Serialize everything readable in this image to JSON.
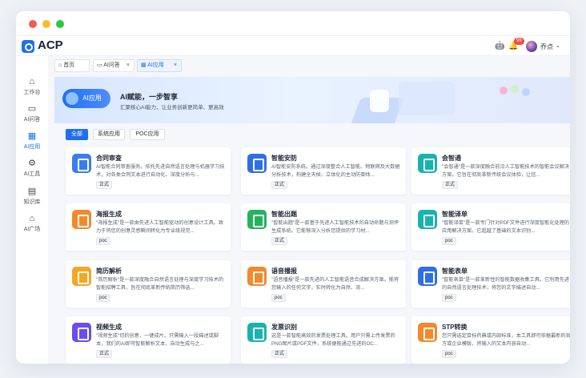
{
  "app": {
    "title": "ACP"
  },
  "header": {
    "notif_count": "99",
    "user_name": "乔点"
  },
  "sidebar": {
    "items": [
      {
        "label": "工作台",
        "icon": "home-icon"
      },
      {
        "label": "AI问答",
        "icon": "chat-icon"
      },
      {
        "label": "AI应用",
        "icon": "apps-icon",
        "active": true
      },
      {
        "label": "AI工具",
        "icon": "tools-icon"
      },
      {
        "label": "知识库",
        "icon": "book-icon"
      },
      {
        "label": "AI广场",
        "icon": "plaza-icon"
      }
    ]
  },
  "tabs": [
    {
      "label": "首页",
      "icon": "home-icon"
    },
    {
      "label": "AI问答",
      "icon": "chat-icon",
      "closable": true
    },
    {
      "label": "AI应用",
      "icon": "apps-icon",
      "closable": true,
      "active": true
    }
  ],
  "hero": {
    "pill": "AI应用",
    "title": "AI赋能，一步智享",
    "subtitle": "汇聚核心AI能力，让业务创新更简单、更高效"
  },
  "filters": [
    "全部",
    "系统应用",
    "POC应用"
  ],
  "cards": [
    {
      "title": "合同审查",
      "desc": "AI智能合同审查服务。依托先进自然语言处理与机器学习技术，对各类合同文本进行自动化、深度分析与...",
      "tag": "正式",
      "color": "#3b7cf0"
    },
    {
      "title": "智能安防",
      "desc": "AI智能安防系统。通过深度整合人工智能、物联网及大数据分析技术，构建全天候、立体化的主动防御体...",
      "tag": "正式",
      "color": "#2f6fe4"
    },
    {
      "title": "会智通",
      "desc": "\"会智通\"是一款深度融合前沿人工智能技术的智能会议解决方案。它旨在彻底革新传统会议体验，让信...",
      "tag": "正式",
      "color": "#17b3b0"
    },
    {
      "title": "海报生成",
      "desc": "\"海报生成\"是一款由先进人工智能驱动的创意设计工具。致力于将您的创意灵感瞬间转化为专业级视觉...",
      "tag": "poc",
      "color": "#f28a2c"
    },
    {
      "title": "智能出题",
      "desc": "\"智能出题\"是一款基于先进人工智能技术的自动命题与测评生成系统。它能够深入分析您提供的学习材...",
      "tag": "正式",
      "color": "#22b35e"
    },
    {
      "title": "智能译单",
      "desc": "\"智能译单\"是一款专门针对PDF文件进行深度智能化处理的应用解决方案。它超越了基础的文本识别...",
      "tag": "poc",
      "color": "#17b3b0"
    },
    {
      "title": "简历解析",
      "desc": "\"简历解析\"是一款深度融合自然语言处理与深度学习技术的智能招聘工具，旨在彻底革新传统简历筛选...",
      "tag": "poc",
      "color": "#f5a623"
    },
    {
      "title": "语音播报",
      "desc": "\"语音播报\"是一款先进的人工智能语音合成解决方案。能将您输入的任何文字，实时转化为自然、流...",
      "tag": "poc",
      "color": "#f28a2c"
    },
    {
      "title": "智能表单",
      "desc": "\"智能表单\"是一款革新性的智能数据收集工具。它利用先进的自然语言处理技术，将您的文字描述自动...",
      "tag": "poc",
      "color": "#2f6fe4"
    },
    {
      "title": "视频生成",
      "desc": "\"视频生成\"切的创意，一键成片。只需输入一段描述或脚本，我们的AI即可智能解析文本，自动生成与之...",
      "tag": "正式",
      "color": "#6a4cf0"
    },
    {
      "title": "发票识别",
      "desc": "这是一款智能高效的发票处理工具。用户只需上传发票的PNG图片或PDF文件，系统便能通过先进的OC...",
      "tag": "正式",
      "color": "#17b3b0"
    },
    {
      "title": "STP转换",
      "desc": "您只需选定目标药典或内部标准，本工具即可依据最新的官方或企业模版，将输入的文本内容自动...",
      "tag": "poc",
      "color": "#f28a2c"
    }
  ]
}
